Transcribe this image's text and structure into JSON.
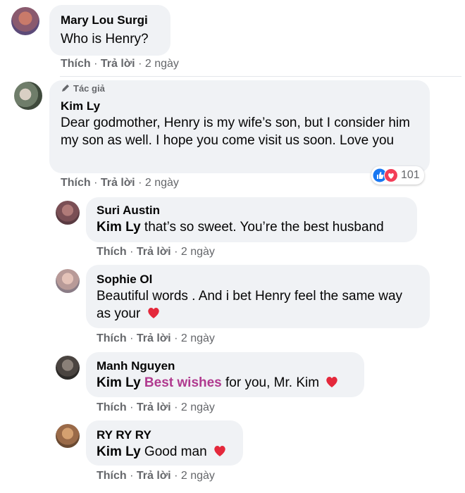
{
  "comments": [
    {
      "name": "Mary Lou Surgi",
      "text": "Who is Henry?",
      "like": "Thích",
      "reply": "Trả lời",
      "time": "2 ngày"
    },
    {
      "badge": "Tác giả",
      "name": "Kim Ly",
      "text": "Dear godmother, Henry is my wife’s son, but I consider him my son as well. I hope you come visit us soon. Love you",
      "like": "Thích",
      "reply": "Trả lời",
      "time": "2 ngày",
      "reaction_count": "101"
    }
  ],
  "replies": [
    {
      "name": "Suri Austin",
      "mention": "Kim Ly",
      "text": " that’s so sweet. You’re the best husband",
      "like": "Thích",
      "reply": "Trả lời",
      "time": "2 ngày"
    },
    {
      "name": "Sophie Ol",
      "text": "Beautiful words . And i bet Henry feel the same way as your",
      "like": "Thích",
      "reply": "Trả lời",
      "time": "2 ngày"
    },
    {
      "name": "Manh Nguyen",
      "mention": "Kim Ly",
      "highlight": "Best wishes",
      "text": " for you, Mr. Kim",
      "like": "Thích",
      "reply": "Trả lời",
      "time": "2 ngày"
    },
    {
      "name": "RY RY RY",
      "mention": "Kim Ly",
      "text": " Good man",
      "like": "Thích",
      "reply": "Trả lời",
      "time": "2 ngày"
    }
  ],
  "icons": {
    "heart": "heart-icon",
    "like_reaction": "like-reaction-icon",
    "love_reaction": "love-reaction-icon",
    "pencil": "pencil-icon"
  },
  "colors": {
    "bubble": "#f0f2f5",
    "meta": "#65676b",
    "like_blue": "#1877f2",
    "love_red": "#f33e58",
    "highlight": "#b03a8f"
  }
}
